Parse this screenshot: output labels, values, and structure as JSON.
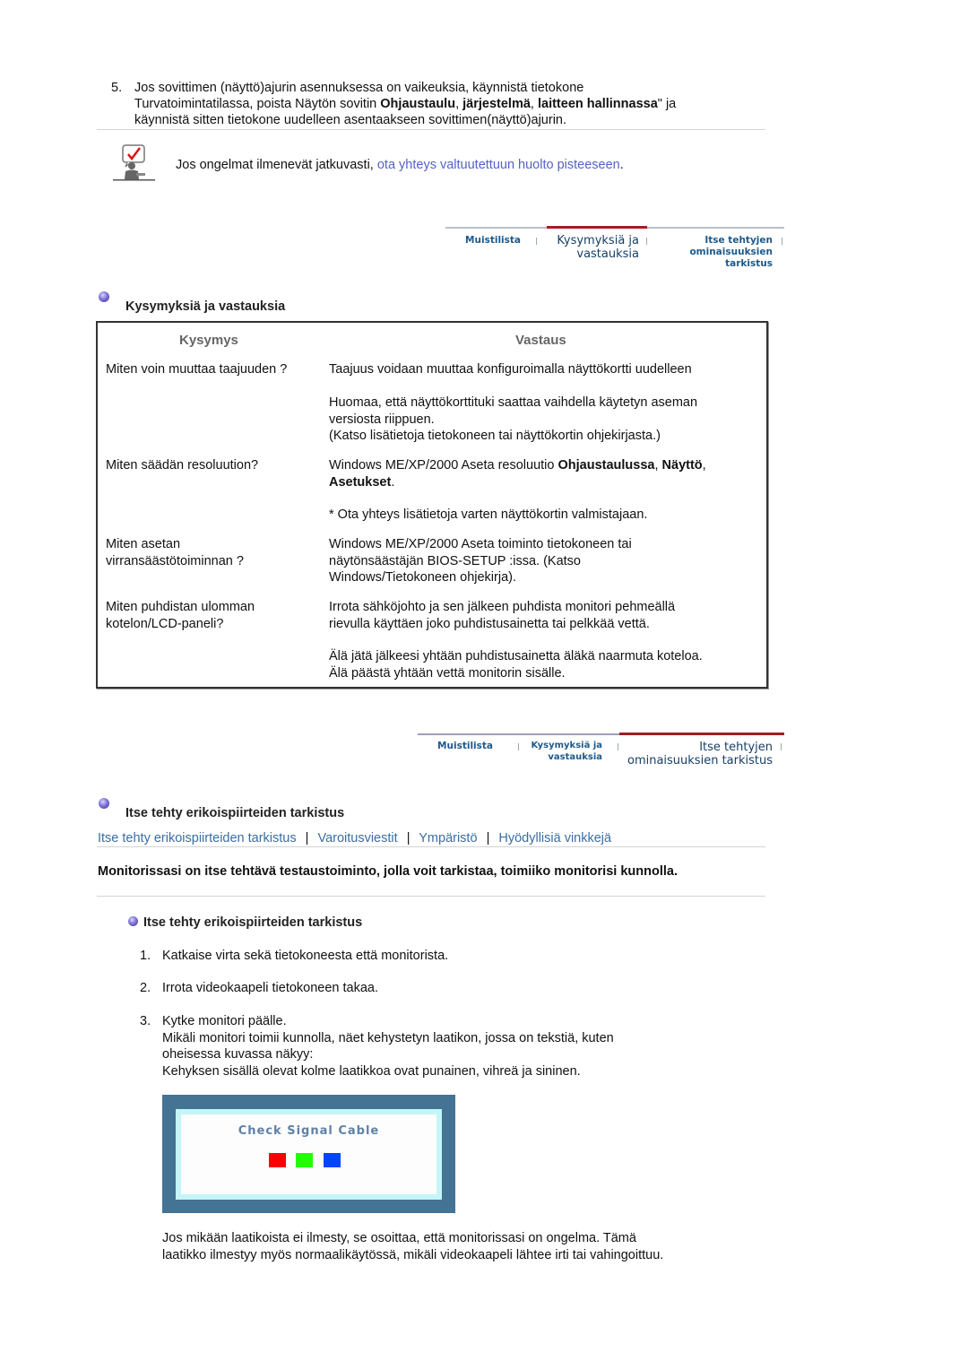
{
  "step5": {
    "number": "5.",
    "line1": "Jos sovittimen (näyttö)ajurin asennuksessa on vaikeuksia, käynnistä tietokone",
    "line2_pre": "Turvatoimintatilassa, poista Näytön sovitin ",
    "line2_b1": "Ohjaustaulu",
    "line2_sep1": ", ",
    "line2_b2": "järjestelmä",
    "line2_sep2": ", ",
    "line2_b3": "laitteen hallinnassa",
    "line2_post": "\" ja",
    "line3": "käynnistä sitten tietokone uudelleen asentaakseen sovittimen(näyttö)ajurin."
  },
  "note": {
    "icon": "checkmark-speech-person-icon",
    "text": "Jos ongelmat ilmenevät jatkuvasti, ",
    "link": "ota yhteys valtuutettuun huolto pisteeseen",
    "end": "."
  },
  "nav1": {
    "tabs": [
      {
        "label": "Muistilista"
      },
      {
        "label_l1": "Kysymyksiä ja",
        "label_l2": "vastauksia",
        "active": true
      },
      {
        "label_l1": "Itse tehtyjen",
        "label_l2": "ominaisuuksien tarkistus"
      }
    ]
  },
  "qa_section": {
    "title": "Kysymyksiä ja vastauksia",
    "col_question": "Kysymys",
    "col_answer": "Vastaus",
    "rows": [
      {
        "q": "Miten voin muuttaa taajuuden ?",
        "a": "Taajuus voidaan muuttaa konfiguroimalla näyttökortti uudelleen"
      },
      {
        "a1": "Huomaa, että näyttökorttituki saattaa vaihdella käytetyn aseman",
        "a2": "versiosta riippuen.",
        "a3": "(Katso lisätietoja tietokoneen tai näyttökortin ohjekirjasta.)"
      },
      {
        "q": "Miten säädän resoluution?",
        "a_pre": "Windows ME/XP/2000 Aseta resoluutio ",
        "a_b1": "Ohjaustaulussa",
        "a_sep": ", ",
        "a_b2": "Näyttö",
        "a_sep2": ",",
        "a_b3": "Asetukset",
        "a_end": "."
      },
      {
        "a": "* Ota yhteys lisätietoja varten näyttökortin valmistajaan."
      },
      {
        "q1": "Miten asetan",
        "q2": "virransäästötoiminnan ?",
        "a1": "Windows ME/XP/2000 Aseta toiminto tietokoneen tai",
        "a2": "näytönsäästäjän BIOS-SETUP :issa. (Katso",
        "a3": "Windows/Tietokoneen ohjekirja)."
      },
      {
        "q1": "Miten puhdistan ulomman",
        "q2": "kotelon/LCD-paneli?",
        "a1": "Irrota sähköjohto ja sen jälkeen puhdista monitori pehmeällä",
        "a2": "rievulla käyttäen joko puhdistusainetta tai pelkkää vettä."
      },
      {
        "a1": "Älä jätä jälkeesi yhtään puhdistusainetta äläkä naarmuta koteloa.",
        "a2": "Älä päästä yhtään vettä monitorin sisälle."
      }
    ]
  },
  "nav2": {
    "tabs": [
      {
        "label": "Muistilista"
      },
      {
        "label_l1": "Kysymyksiä ja",
        "label_l2": "vastauksia"
      },
      {
        "label_l1": "Itse tehtyjen",
        "label_l2": "ominaisuuksien tarkistus",
        "active": true
      }
    ]
  },
  "selftest": {
    "title": "Itse tehty erikoispiirteiden tarkistus",
    "links": [
      "Itse tehty erikoispiirteiden tarkistus",
      "Varoitusviestit",
      "Ympäristö",
      "Hyödyllisiä vinkkejä"
    ],
    "separator": "|",
    "intro": "Monitorissasi on itse tehtävä testaustoiminto, jolla voit tarkistaa, toimiiko monitorisi kunnolla.",
    "subtitle": "Itse tehty erikoispiirteiden tarkistus",
    "steps": [
      {
        "num": "1.",
        "text": "Katkaise virta sekä tietokoneesta että monitorista."
      },
      {
        "num": "2.",
        "text": "Irrota videokaapeli tietokoneen takaa."
      },
      {
        "num": "3.",
        "l1": "Kytke monitori päälle.",
        "l2": "Mikäli monitori toimii kunnolla, näet kehystetyn laatikon, jossa on tekstiä, kuten",
        "l3": "oheisessa kuvassa näkyy:",
        "l4": "Kehyksen sisällä olevat kolme laatikkoa ovat punainen, vihreä ja sininen."
      }
    ],
    "signal_box": {
      "text": "Check Signal Cable",
      "colors": [
        "#ff0000",
        "#22ff00",
        "#0044ff"
      ]
    },
    "footer_l1": "Jos mikään laatikoista ei ilmesty, se osoittaa, että monitorissasi on ongelma. Tämä",
    "footer_l2": "laatikko ilmestyy myös normaalikäytössä, mikäli videokaapeli lähtee irti tai vahingoittuu."
  }
}
